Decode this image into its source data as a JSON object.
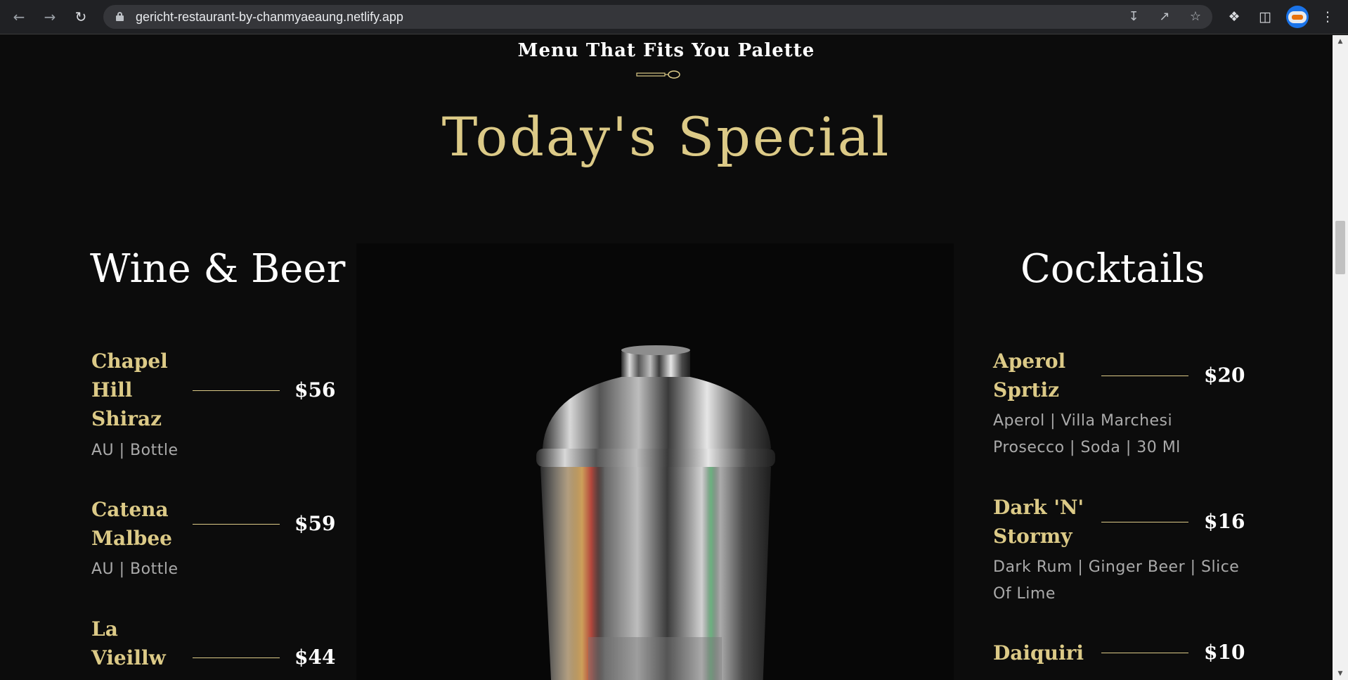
{
  "browser": {
    "url": "gericht-restaurant-by-chanmyaeaung.netlify.app",
    "icons": {
      "back": "back-arrow-icon",
      "forward": "forward-arrow-icon",
      "reload": "reload-icon",
      "lock": "lock-icon",
      "install": "install-app-icon",
      "share": "share-icon",
      "bookmark": "star-icon",
      "extensions": "puzzle-icon",
      "side_panel": "side-panel-icon",
      "profile": "avatar",
      "menu": "kebab-menu-icon"
    }
  },
  "section": {
    "subtitle": "Menu That Fits You Palette",
    "title": "Today's Special"
  },
  "wine": {
    "heading": "Wine & Beer",
    "items": [
      {
        "name": [
          "Chapel",
          "Hill",
          "Shiraz"
        ],
        "price": "$56",
        "tags": [
          "AU | Bottle"
        ]
      },
      {
        "name": [
          "Catena",
          "Malbee"
        ],
        "price": "$59",
        "tags": [
          "AU | Bottle"
        ]
      },
      {
        "name": [
          "La",
          "Vieillw"
        ],
        "price": "$44",
        "tags": []
      }
    ]
  },
  "cocktails": {
    "heading": "Cocktails",
    "items": [
      {
        "name": [
          "Aperol",
          "Sprtiz"
        ],
        "price": "$20",
        "tags": [
          "Aperol | Villa Marchesi",
          "Prosecco | Soda | 30 Ml"
        ]
      },
      {
        "name": [
          "Dark 'N'",
          "Stormy"
        ],
        "price": "$16",
        "tags": [
          "Dark Rum | Ginger Beer | Slice",
          "Of Lime"
        ]
      },
      {
        "name": [
          "Daiquiri"
        ],
        "price": "$10",
        "tags": []
      }
    ]
  },
  "colors": {
    "gold": "#dcca87",
    "background": "#0c0c0c",
    "text": "#ffffff",
    "muted": "#aaaaaa"
  }
}
